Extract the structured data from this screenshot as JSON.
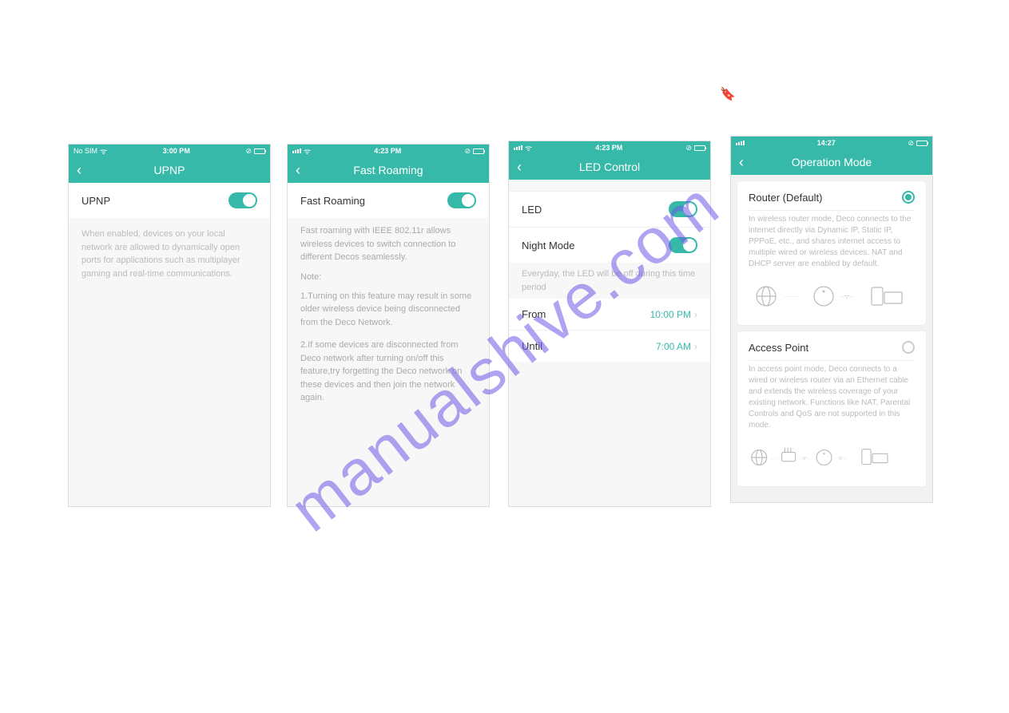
{
  "watermark": "manualshive.com",
  "phones": {
    "upnp": {
      "status": {
        "left": "No SIM",
        "time": "3:00 PM"
      },
      "title": "UPNP",
      "toggle_label": "UPNP",
      "description": "When enabled, devices on your local network are allowed to dynamically open ports for applications such as multiplayer gaming and real-time communications."
    },
    "fast_roaming": {
      "status": {
        "time": "4:23 PM"
      },
      "title": "Fast Roaming",
      "toggle_label": "Fast Roaming",
      "description": "Fast roaming with IEEE 802.11r allows wireless devices to switch connection to different Decos seamlessly.",
      "note_label": "Note:",
      "note1": "1.Turning on this feature may result in some older wireless device being disconnected  from the Deco Network.",
      "note2": "2.If some devices are disconnected from Deco network after turning on/off this feature,try forgetting the Deco network on these devices and then join the network again."
    },
    "led": {
      "status": {
        "time": "4:23 PM"
      },
      "title": "LED Control",
      "led_label": "LED",
      "night_label": "Night Mode",
      "night_desc": "Everyday, the LED will be off during this time period",
      "from_label": "From",
      "from_value": "10:00 PM",
      "until_label": "Until",
      "until_value": "7:00 AM"
    },
    "mode": {
      "status": {
        "time": "14:27"
      },
      "title": "Operation Mode",
      "router_title": "Router (Default)",
      "router_desc": "In wireless router mode, Deco connects to the internet directly via Dynamic IP, Static IP, PPPoE, etc., and shares internet access to multiple wired or wireless devices. NAT and DHCP server are enabled by default.",
      "ap_title": "Access Point",
      "ap_desc": "In access point mode, Deco connects to a wired or wireless router via an Ethernet cable and extends the wireless coverage of your existing network. Functions like NAT, Parental Controls and QoS are not supported in this mode."
    }
  }
}
